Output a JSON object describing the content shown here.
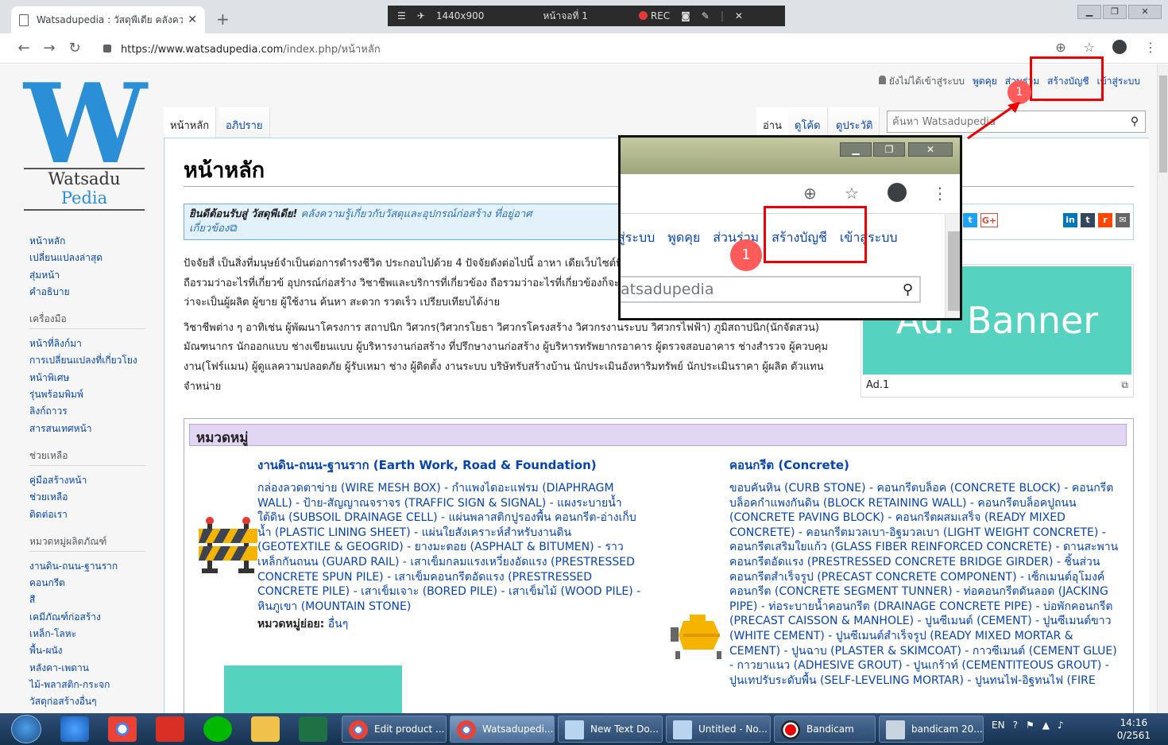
{
  "browser": {
    "tab_title": "Watsadupedia : วัสดุพีเดีย คลังความ",
    "tab_close": "✕",
    "new_tab": "+",
    "recorder": {
      "resolution": "1440x900",
      "monitor": "หน้าจอที่ 1",
      "rec_label": "REC"
    },
    "window_controls": [
      "▁",
      "❐",
      "✕"
    ],
    "url_host": "https://www.watsadupedia.com",
    "url_path": "/index.php/หน้าหลัก"
  },
  "logo": {
    "name_a": "Watsadu",
    "name_b": "Pedia",
    "mark": "W"
  },
  "personal": {
    "anon": "ยังไม่ได้เข้าสู่ระบบ",
    "talk": "พูดคุย",
    "contrib": "ส่วนร่วม",
    "create_account": "สร้างบัญชี",
    "login": "เข้าสู่ระบบ"
  },
  "tabs": {
    "main": "หน้าหลัก",
    "discussion": "อภิปราย",
    "read": "อ่าน",
    "view_source": "ดูโค้ด",
    "history": "ดูประวัติ",
    "search_placeholder": "ค้นหา Watsadupedia"
  },
  "sidebar": {
    "nav": [
      "หน้าหลัก",
      "เปลี่ยนแปลงล่าสุด",
      "สุ่มหน้า",
      "คำอธิบาย"
    ],
    "tools_heading": "เครื่องมือ",
    "tools": [
      "หน้าที่ลิงก์มา",
      "การเปลี่ยนแปลงที่เกี่ยวโยง",
      "หน้าพิเศษ",
      "รุ่นพร้อมพิมพ์",
      "ลิงก์ถาวร",
      "สารสนเทศหน้า"
    ],
    "help_heading": "ช่วยเหลือ",
    "help": [
      "คู่มือสร้างหน้า",
      "ช่วยเหลือ",
      "ติดต่อเรา"
    ],
    "cat_heading": "หมวดหมู่ผลิตภัณฑ์",
    "cats": [
      "งานดิน-ถนน-ฐานราก",
      "คอนกรีต",
      "สี",
      "เคมีภัณฑ์ก่อสร้าง",
      "เหล็ก-โลหะ",
      "พื้น-ผนัง",
      "หลังคา-เพดาน",
      "ไม้-พลาสติก-กระจก",
      "วัสดุก่อสร้างอื่นๆ"
    ]
  },
  "content": {
    "title": "หน้าหลัก",
    "welcome_bold": "ยินดีต้อนรับสู่ วัสดุพีเดีย!",
    "welcome_text": " คลังความรู้เกี่ยวกับวัสดุและอุปกรณ์ก่อสร้าง ที่อยู่อาศ",
    "welcome_text2": "เกี่ยวข้อง",
    "intro_p1": "ปัจจัยสี่ เป็นสิ่งที่มนุษย์จำเป็นต่อการดำรงชีวิต ประกอบไปด้วย 4 ปัจจัยดังต่อไปนี้ อาหา เดียเว็บไซต์ที่รวบรวมเกี่ยวกับหนึ่งในปัจจัยสี่ คือ ด้านที่อยู่อาศัย ถือรวมว่าอะไรที่เกี่ยวข้ อุปกรณ์ก่อสร้าง วิชาชีพและบริการที่เกี่ยวข้อง ถือรวมว่าอะไรที่เกี่ยวข้องก็จะถูกรวบรวม การรีวิว เป็นสื่อกลางให้กับทุกท่านไม่ว่าจะเป็นผู้ผลิต ผู้ขาย ผู้ใช้งาน ค้นหา สะดวก รวดเร็ว เปรียบเทียบได้ง่าย",
    "intro_p2": "วิชาชีพต่าง ๆ อาทิเช่น ผู้พัฒนาโครงการ สถาปนิก วิศวกร(วิศวกรโยธา วิศวกรโครงสร้าง วิศวกรงานระบบ วิศวกรไฟฟ้า) ภูมิสถาปนิก(นักจัดสวน) มัณฑนากร นักออกแบบ ช่างเขียนแบบ ผู้บริหารงานก่อสร้าง ที่ปรึกษางานก่อสร้าง ผู้บริหารทรัพยากรอาคาร ผู้ตรวจสอบอาคาร ช่างสำรวจ ผู้ควบคุมงาน(โฟร์แมน) ผู้ดูแลความปลอดภัย ผู้รับเหมา ช่าง ผู้ติดตั้ง งานระบบ บริษัทรับสร้างบ้าน นักประเมินอังหาริมทรัพย์ นักประเมินราคา ผู้ผลิต ตัวแทนจำหน่าย"
  },
  "share": {
    "twitter": "t",
    "gplus": "G+",
    "linkedin": "in",
    "tumblr": "t",
    "reddit": "r",
    "mail": "✉"
  },
  "ad": {
    "banner": "Ad. Banner",
    "label": "Ad.1",
    "ext_icon": "⧉"
  },
  "categories": {
    "heading": "หมวดหมู่",
    "col1_title": "งานดิน-ถนน-ฐานราก (Earth Work, Road & Foundation)",
    "col1_text": "กล่องลวดตาข่าย (WIRE MESH BOX) - กำแพงไดอะแฟรม (DIAPHRAGM WALL) - ป้าย-สัญญาณจราจร (TRAFFIC SIGN & SIGNAL) - แผงระบายน้ำใต้ดิน (SUBSOIL DRAINAGE CELL) - แผ่นพลาสติกปูรองพื้น คอนกรีต-อ่างเก็บน้ำ (PLASTIC LINING SHEET) - แผ่นใยสังเคราะห์สำหรับงานดิน (GEOTEXTILE & GEOGRID) - ยางมะตอย (ASPHALT & BITUMEN) - ราวเหล็กกันถนน (GUARD RAIL) - เสาเข็มกลมแรงเหวี่ยงอัดแรง (PRESTRESSED CONCRETE SPUN PILE) - เสาเข็มคอนกรีตอัดแรง (PRESTRESSED CONCRETE PILE) - เสาเข็มเจาะ (BORED PILE) - เสาเข็มไม้ (WOOD PILE) - หินภูเขา (MOUNTAIN STONE)",
    "sub_label": "หมวดหมู่ย่อย:",
    "sub_value": " อื่นๆ",
    "col2_title": "คอนกรีต (Concrete)",
    "col2_text": "ขอบคันหิน (CURB STONE) - คอนกรีตบล็อค (CONCRETE BLOCK) - คอนกรีตบล็อคกำแพงกันดิน (BLOCK RETAINING WALL) - คอนกรีตบล็อคปูถนน (CONCRETE PAVING BLOCK) - คอนกรีตผสมเสร็จ (READY MIXED CONCRETE) - คอนกรีตมวลเบา-อิฐมวลเบา (LIGHT WEIGHT CONCRETE) - คอนกรีตเสริมใยแก้ว (GLASS FIBER REINFORCED CONCRETE) - ดานสะพานคอนกรีตอัดแรง (PRESTRESSED CONCRETE BRIDGE GIRDER) - ชิ้นส่วนคอนกรีตสำเร็จรูป (PRECAST CONCRETE COMPONENT) - เซ็กเมนต์อุโมงค์คอนกรีต (CONCRETE SEGMENT TUNNER) - ท่อคอนกรีตดันลอด (JACKING PIPE) - ท่อระบายน้ำคอนกรีต (DRAINAGE CONCRETE PIPE) - บ่อพักคอนกรีต (PRECAST CAISSON & MANHOLE) - ปูนซีเมนต์ (CEMENT) - ปูนซีเมนต์ขาว (WHITE CEMENT) - ปูนซีเมนต์สำเร็จรูป (READY MIXED MORTAR & CEMENT) - ปูนฉาบ (PLASTER & SKIMCOAT) - กาวซีเมนต์ (CEMENT GLUE) - กาวยาแนว (ADHESIVE GROUT) - ปูนเกร้าท์ (CEMENTITEOUS GROUT) - ปูนเทปรับระดับพื้น (SELF-LEVELING MORTAR) - ปูนทนไฟ-อิฐทนไฟ (FIRE"
  },
  "annotations": {
    "badge_number": "1",
    "color": "#ee0000"
  },
  "zoom": {
    "links": [
      "สู่ระบบ",
      "พูดคุย",
      "ส่วนร่วม",
      "สร้างบัญชี",
      "เข้าสู่ระบบ"
    ],
    "search_text": "atsadupedia",
    "badge": "1"
  },
  "taskbar": {
    "buttons": [
      "Edit product ...",
      "Watsadupedi...",
      "New Text Do...",
      "Untitled - No...",
      "Bandicam",
      "bandicam 20..."
    ],
    "lang": "EN",
    "time": "14:16",
    "date": "0/2561"
  }
}
